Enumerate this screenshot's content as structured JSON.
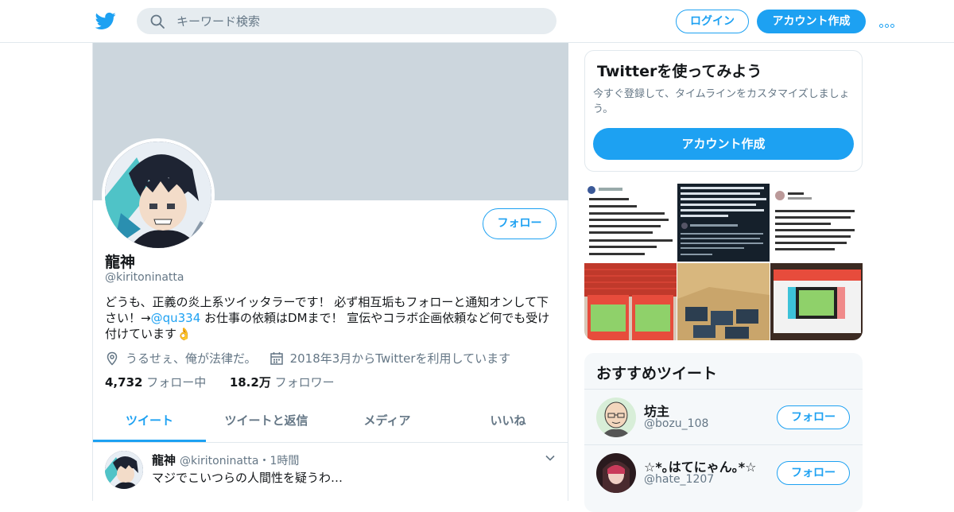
{
  "colors": {
    "accent": "#1da1f2",
    "banner": "#ccd6dd",
    "muted": "#657786"
  },
  "topbar": {
    "logo_icon": "twitter-bird-icon",
    "search_placeholder": "キーワード検索",
    "login_label": "ログイン",
    "signup_label": "アカウント作成",
    "more_icon": "more-dots-icon"
  },
  "profile": {
    "name": "龍神",
    "handle": "@kiritoninatta",
    "follow_label": "フォロー",
    "bio_pre": "どうも、正義の炎上系ツイッタラーです！ 必ず相互垢もフォローと通知オンして下さい！→",
    "bio_mention": "@qu334",
    "bio_post": " お仕事の依頼はDMまで！ 宣伝やコラボ企画依頼など何でも受け付けています👌",
    "location": "うるせぇ、俺が法律だ。",
    "joined": "2018年3月からTwitterを利用しています",
    "following_count": "4,732",
    "following_label": "フォロー中",
    "followers_count": "18.2万",
    "followers_label": "フォロワー"
  },
  "tabs": [
    "ツイート",
    "ツイートと返信",
    "メディア",
    "いいね"
  ],
  "tweet": {
    "name": "龍神",
    "handle_time": "@kiritoninatta・1時間",
    "text": "マジでこいつらの人間性を疑うわ…"
  },
  "sidebar": {
    "try_title": "Twitterを使ってみよう",
    "try_desc": "今すぐ登録して、タイムラインをカスタマイズしましょう。",
    "try_cta": "アカウント作成",
    "reco_title": "おすすめツイート",
    "reco_users": [
      {
        "name": "坊主",
        "handle": "@bozu_108",
        "follow_label": "フォロー"
      },
      {
        "name": "☆*｡はてにゃん｡*☆",
        "handle": "@hate_1207",
        "follow_label": "フォロー"
      }
    ]
  }
}
